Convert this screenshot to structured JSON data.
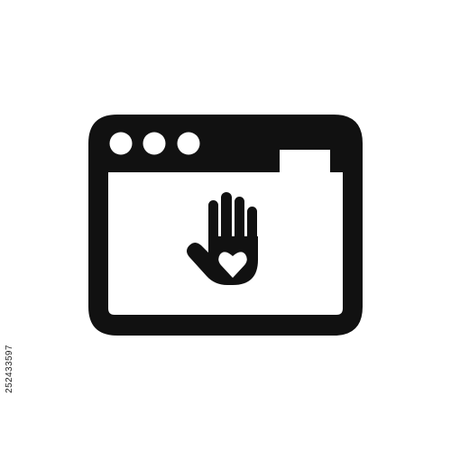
{
  "icon": {
    "name": "browser-window-volunteer-hand-heart-icon",
    "fill_color": "#111111",
    "background_color": "#ffffff",
    "window_dots": 3
  },
  "stock_id": "252433597"
}
